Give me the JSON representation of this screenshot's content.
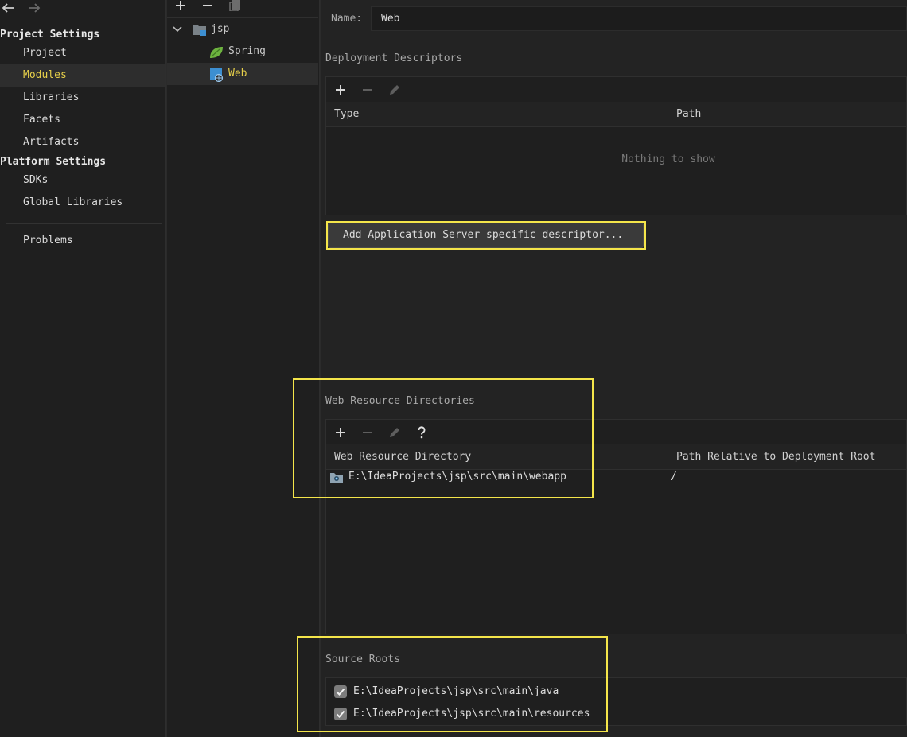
{
  "header": {
    "back_icon": "arrow-left-icon",
    "forward_icon": "arrow-right-icon"
  },
  "sidebar": {
    "project_settings_label": "Project Settings",
    "project_items": [
      {
        "label": "Project"
      },
      {
        "label": "Modules",
        "selected": true
      },
      {
        "label": "Libraries"
      },
      {
        "label": "Facets"
      },
      {
        "label": "Artifacts"
      }
    ],
    "platform_settings_label": "Platform Settings",
    "platform_items": [
      {
        "label": "SDKs"
      },
      {
        "label": "Global Libraries"
      }
    ],
    "problems_label": "Problems"
  },
  "module_tree": {
    "toolbar_icons": [
      "plus-icon",
      "minus-icon",
      "copy-icon"
    ],
    "root": {
      "label": "jsp",
      "expanded": true
    },
    "children": [
      {
        "label": "Spring",
        "icon": "spring-leaf-icon"
      },
      {
        "label": "Web",
        "icon": "web-facet-icon",
        "selected": true
      }
    ]
  },
  "facet": {
    "name_label": "Name:",
    "name_value": "Web"
  },
  "deployment": {
    "title": "Deployment Descriptors",
    "columns": [
      "Type",
      "Path"
    ],
    "empty_text": "Nothing to show",
    "add_button": "Add Application Server specific descriptor..."
  },
  "web_resources": {
    "title": "Web Resource Directories",
    "columns": [
      "Web Resource Directory",
      "Path Relative to Deployment Root"
    ],
    "rows": [
      {
        "directory": "E:\\IdeaProjects\\jsp\\src\\main\\webapp",
        "relative_path": "/"
      }
    ]
  },
  "source_roots": {
    "title": "Source Roots",
    "items": [
      {
        "path": "E:\\IdeaProjects\\jsp\\src\\main\\java",
        "checked": true
      },
      {
        "path": "E:\\IdeaProjects\\jsp\\src\\main\\resources",
        "checked": true
      }
    ]
  },
  "colors": {
    "background": "#2b2b2b",
    "sidebar": "#1f1f1f",
    "selected_text": "#e6cf4a",
    "highlight_border": "#f4e54a",
    "spring_green": "#6db33f",
    "web_blue": "#3d8fd1"
  }
}
